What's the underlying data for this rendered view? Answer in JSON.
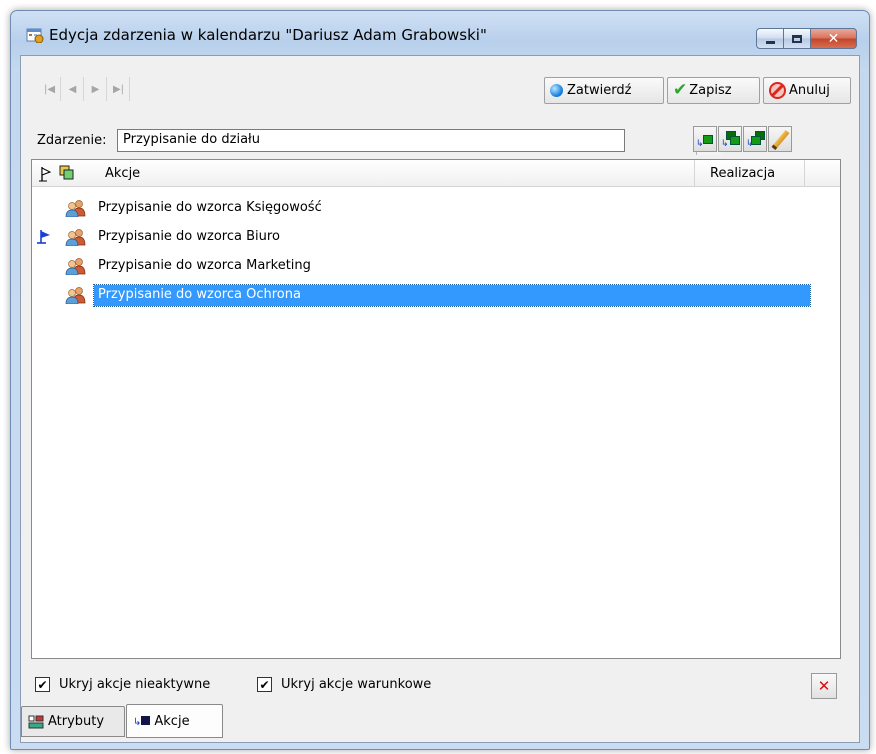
{
  "window": {
    "title": "Edycja zdarzenia w kalendarzu \"Dariusz Adam Grabowski\""
  },
  "toolbar": {
    "nav": [
      "|◀",
      "◀",
      "▶",
      "▶|"
    ],
    "confirm_label": "Zatwierdź",
    "save_label": "Zapisz",
    "cancel_label": "Anuluj"
  },
  "event": {
    "label": "Zdarzenie:",
    "value": "Przypisanie do działu"
  },
  "list": {
    "header_actions": "Akcje",
    "header_realization": "Realizacja",
    "items": [
      {
        "label": "Przypisanie do wzorca Księgowość",
        "flag": false,
        "selected": false
      },
      {
        "label": "Przypisanie do wzorca Biuro",
        "flag": true,
        "selected": false
      },
      {
        "label": "Przypisanie do wzorca Marketing",
        "flag": false,
        "selected": false
      },
      {
        "label": "Przypisanie do wzorca Ochrona",
        "flag": false,
        "selected": true
      }
    ]
  },
  "options": {
    "hide_inactive_label": "Ukryj akcje nieaktywne",
    "hide_inactive_checked": true,
    "hide_conditional_label": "Ukryj akcje warunkowe",
    "hide_conditional_checked": true
  },
  "tabs": [
    {
      "label": "Atrybuty",
      "active": false
    },
    {
      "label": "Akcje",
      "active": true
    }
  ],
  "colors": {
    "selection": "#3399ff",
    "flag": "#1a3fd6"
  }
}
